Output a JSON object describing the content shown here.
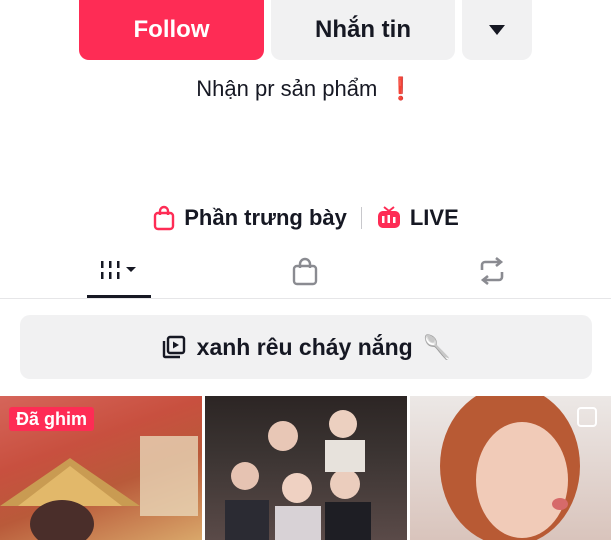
{
  "profile": {
    "follow_label": "Follow",
    "message_label": "Nhắn tin",
    "more_icon": "triangle-down-icon",
    "bio": "Nhận pr sản phẩm",
    "bio_emoji": "❗"
  },
  "links": {
    "showcase_label": "Phần trưng bày",
    "live_label": "LIVE"
  },
  "tabs": [
    {
      "name": "videos",
      "icon": "grid-icon",
      "active": true
    },
    {
      "name": "shop",
      "icon": "bag-icon",
      "active": false
    },
    {
      "name": "reposts",
      "icon": "repost-icon",
      "active": false
    }
  ],
  "playlist": {
    "label": "xanh rêu cháy nắng",
    "emoji": "🥄"
  },
  "videos": [
    {
      "badge": "Đã ghim"
    },
    {
      "badge": ""
    },
    {
      "badge": ""
    }
  ],
  "colors": {
    "accent": "#fe2c55",
    "button_bg": "#f1f1f2",
    "text": "#161823"
  }
}
